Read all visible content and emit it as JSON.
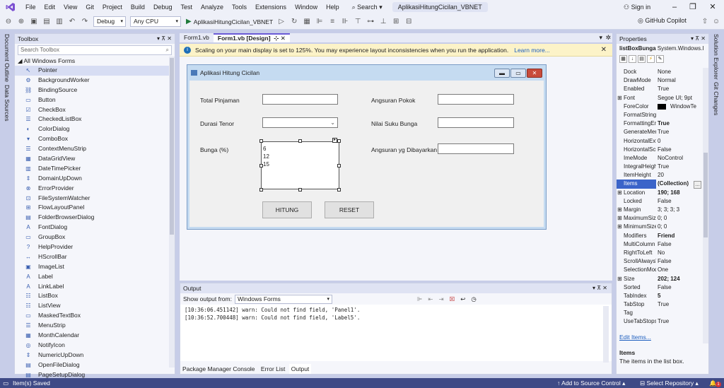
{
  "menubar": {
    "items": [
      "File",
      "Edit",
      "View",
      "Git",
      "Project",
      "Build",
      "Debug",
      "Test",
      "Analyze",
      "Tools",
      "Extensions",
      "Window",
      "Help"
    ],
    "search_label": "Search",
    "solution_name": "AplikasiHitungCicilan_VBNET",
    "signin_label": "Sign in"
  },
  "toolbar": {
    "config_value": "Debug",
    "platform_value": "Any CPU",
    "run_target": "AplikasiHitungCicilan_VBNET",
    "copilot_label": "GitHub Copilot"
  },
  "side_tabs": {
    "left": [
      "Document Outline",
      "Data Sources"
    ],
    "right": [
      "Solution Explorer",
      "Git Changes"
    ]
  },
  "toolbox": {
    "title": "Toolbox",
    "search_placeholder": "Search Toolbox",
    "group_label": "All Windows Forms",
    "items": [
      {
        "label": "Pointer",
        "icon": "pointer-icon"
      },
      {
        "label": "BackgroundWorker",
        "icon": "backgroundworker-icon"
      },
      {
        "label": "BindingSource",
        "icon": "bindingsource-icon"
      },
      {
        "label": "Button",
        "icon": "button-icon"
      },
      {
        "label": "CheckBox",
        "icon": "checkbox-icon"
      },
      {
        "label": "CheckedListBox",
        "icon": "checkedlistbox-icon"
      },
      {
        "label": "ColorDialog",
        "icon": "colordialog-icon"
      },
      {
        "label": "ComboBox",
        "icon": "combobox-icon"
      },
      {
        "label": "ContextMenuStrip",
        "icon": "contextmenustrip-icon"
      },
      {
        "label": "DataGridView",
        "icon": "datagridview-icon"
      },
      {
        "label": "DateTimePicker",
        "icon": "datetimepicker-icon"
      },
      {
        "label": "DomainUpDown",
        "icon": "domainupdown-icon"
      },
      {
        "label": "ErrorProvider",
        "icon": "errorprovider-icon"
      },
      {
        "label": "FileSystemWatcher",
        "icon": "filesystemwatcher-icon"
      },
      {
        "label": "FlowLayoutPanel",
        "icon": "flowlayoutpanel-icon"
      },
      {
        "label": "FolderBrowserDialog",
        "icon": "folderbrowserdialog-icon"
      },
      {
        "label": "FontDialog",
        "icon": "fontdialog-icon"
      },
      {
        "label": "GroupBox",
        "icon": "groupbox-icon"
      },
      {
        "label": "HelpProvider",
        "icon": "helpprovider-icon"
      },
      {
        "label": "HScrollBar",
        "icon": "hscrollbar-icon"
      },
      {
        "label": "ImageList",
        "icon": "imagelist-icon"
      },
      {
        "label": "Label",
        "icon": "label-icon"
      },
      {
        "label": "LinkLabel",
        "icon": "linklabel-icon"
      },
      {
        "label": "ListBox",
        "icon": "listbox-icon"
      },
      {
        "label": "ListView",
        "icon": "listview-icon"
      },
      {
        "label": "MaskedTextBox",
        "icon": "maskedtextbox-icon"
      },
      {
        "label": "MenuStrip",
        "icon": "menustrip-icon"
      },
      {
        "label": "MonthCalendar",
        "icon": "monthcalendar-icon"
      },
      {
        "label": "NotifyIcon",
        "icon": "notifyicon-icon"
      },
      {
        "label": "NumericUpDown",
        "icon": "numericupdown-icon"
      },
      {
        "label": "OpenFileDialog",
        "icon": "openfiledialog-icon"
      },
      {
        "label": "PageSetupDialog",
        "icon": "pagesetupdialog-icon"
      }
    ]
  },
  "doc_tabs": [
    {
      "label": "Form1.vb",
      "active": false
    },
    {
      "label": "Form1.vb [Design]",
      "active": true
    }
  ],
  "infobar": {
    "message": "Scaling on your main display is set to 125%. You may experience layout inconsistencies when you run the application.",
    "link": "Learn more..."
  },
  "form": {
    "title": "Aplikasi Hitung Cicilan",
    "label_total": "Total Pinjaman",
    "label_durasi": "Durasi Tenor",
    "label_bunga": "Bunga (%)",
    "label_angsuran_pokok": "Angsuran Pokok",
    "label_nilai_bunga": "Nilai Suku Bunga",
    "label_angsuran_bayar": "Angsuran yg Dibayarkan",
    "bunga_items": [
      "6",
      "12",
      "15"
    ],
    "button_hitung": "HITUNG",
    "button_reset": "RESET"
  },
  "output": {
    "title": "Output",
    "show_from_label": "Show output from:",
    "source": "Windows Forms",
    "lines": [
      "[10:36:06.451142] warn: Could not find field, 'Panel1'.",
      "[10:36:52.700448] warn: Could not find field, 'Label5'."
    ],
    "tabs": [
      "Package Manager Console",
      "Error List",
      "Output"
    ]
  },
  "properties": {
    "title": "Properties",
    "object_name": "listBoxBunga",
    "object_type": "System.Windows.I",
    "rows": [
      {
        "key": "Dock",
        "value": "None"
      },
      {
        "key": "DrawMode",
        "value": "Normal"
      },
      {
        "key": "Enabled",
        "value": "True"
      },
      {
        "key": "Font",
        "value": "Segoe UI; 9pt",
        "expand": true
      },
      {
        "key": "ForeColor",
        "value": "WindowTe",
        "swatch": "#000000"
      },
      {
        "key": "FormatString",
        "value": ""
      },
      {
        "key": "FormattingEna",
        "value": "True",
        "bold": true
      },
      {
        "key": "GenerateMem",
        "value": "True"
      },
      {
        "key": "HorizontalExte",
        "value": "0"
      },
      {
        "key": "HorizontalScro",
        "value": "False"
      },
      {
        "key": "ImeMode",
        "value": "NoControl"
      },
      {
        "key": "IntegralHeight",
        "value": "True"
      },
      {
        "key": "ItemHeight",
        "value": "20"
      },
      {
        "key": "Items",
        "value": "(Collection)",
        "selected": true,
        "bold": true
      },
      {
        "key": "Location",
        "value": "190; 168",
        "expand": true,
        "bold": true
      },
      {
        "key": "Locked",
        "value": "False"
      },
      {
        "key": "Margin",
        "value": "3; 3; 3; 3",
        "expand": true
      },
      {
        "key": "MaximumSize",
        "value": "0; 0",
        "expand": true
      },
      {
        "key": "MinimumSize",
        "value": "0; 0",
        "expand": true
      },
      {
        "key": "Modifiers",
        "value": "Friend",
        "bold": true
      },
      {
        "key": "MultiColumn",
        "value": "False"
      },
      {
        "key": "RightToLeft",
        "value": "No"
      },
      {
        "key": "ScrollAlwaysVi",
        "value": "False"
      },
      {
        "key": "SelectionMode",
        "value": "One"
      },
      {
        "key": "Size",
        "value": "202; 124",
        "expand": true,
        "bold": true
      },
      {
        "key": "Sorted",
        "value": "False"
      },
      {
        "key": "TabIndex",
        "value": "5",
        "bold": true
      },
      {
        "key": "TabStop",
        "value": "True"
      },
      {
        "key": "Tag",
        "value": ""
      },
      {
        "key": "UseTabStops",
        "value": "True"
      }
    ],
    "edit_items_link": "Edit Items...",
    "desc_title": "Items",
    "desc_text": "The items in the list box."
  },
  "statusbar": {
    "left": "Item(s) Saved",
    "source_control": "Add to Source Control",
    "select_repo": "Select Repository",
    "notifications": "1"
  },
  "colors": {
    "accent": "#6b5bd6",
    "statusbar": "#3f4a86",
    "selection": "#3b64c9",
    "infobar": "#fcf3c8"
  }
}
